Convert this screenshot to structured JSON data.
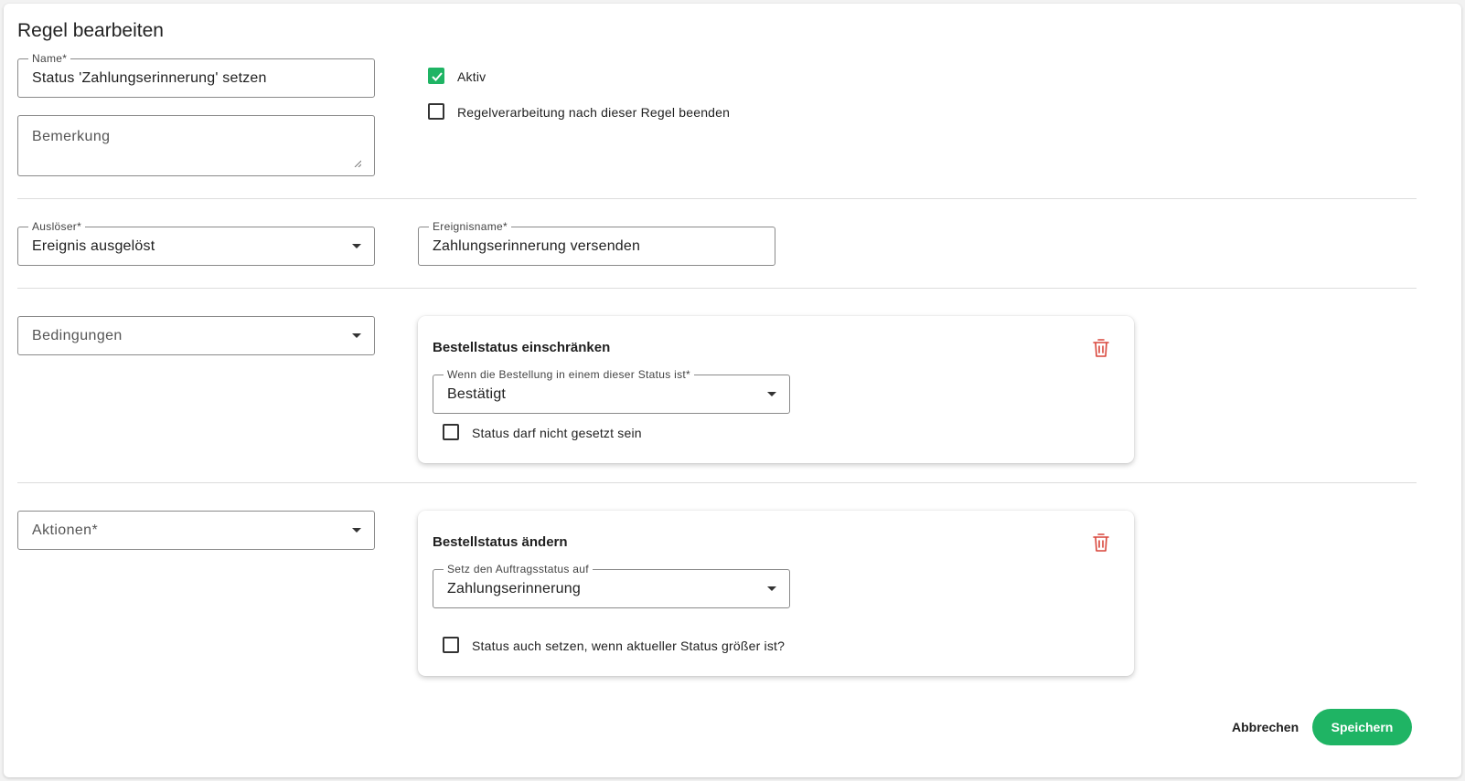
{
  "dialog": {
    "title": "Regel bearbeiten"
  },
  "general": {
    "name_label": "Name*",
    "name_value": "Status 'Zahlungserinnerung' setzen",
    "remark_placeholder": "Bemerkung",
    "active_label": "Aktiv",
    "active_checked": true,
    "stop_processing_label": "Regelverarbeitung nach dieser Regel beenden",
    "stop_processing_checked": false
  },
  "trigger": {
    "trigger_label": "Auslöser*",
    "trigger_value": "Ereignis ausgelöst",
    "event_name_label": "Ereignisname*",
    "event_name_value": "Zahlungserinnerung versenden"
  },
  "conditions": {
    "select_placeholder": "Bedingungen",
    "card": {
      "title": "Bestellstatus einschränken",
      "status_label": "Wenn die Bestellung in einem dieser Status ist*",
      "status_value": "Bestätigt",
      "negate_label": "Status darf nicht gesetzt sein",
      "negate_checked": false
    }
  },
  "actions": {
    "select_placeholder": "Aktionen*",
    "card": {
      "title": "Bestellstatus ändern",
      "status_label": "Setz den Auftragsstatus auf",
      "status_value": "Zahlungserinnerung",
      "force_label": "Status auch setzen, wenn aktueller Status größer ist?",
      "force_checked": false
    }
  },
  "footer": {
    "cancel_label": "Abbrechen",
    "save_label": "Speichern"
  },
  "colors": {
    "accent": "#1fb464",
    "danger": "#d9453a",
    "border": "#8a8a8a",
    "divider": "#dcdcdc"
  }
}
